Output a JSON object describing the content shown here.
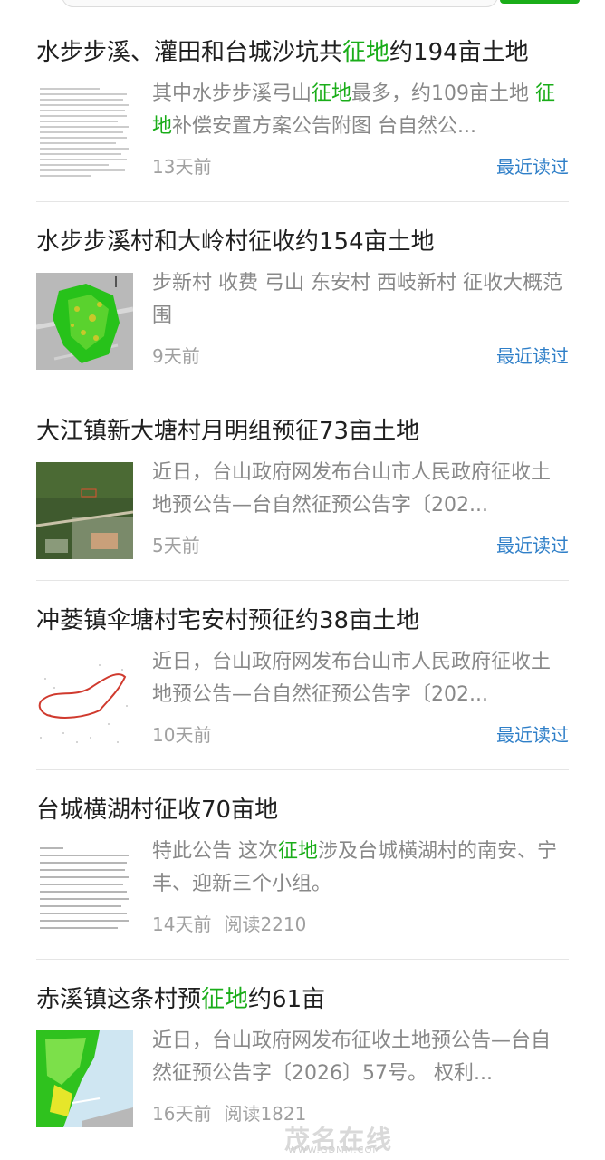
{
  "articles": [
    {
      "title_parts": [
        "水步步溪、灌田和台城沙坑共",
        "征地",
        "约194亩土地"
      ],
      "snippet_parts": [
        "其中水步步溪弓山",
        "征地",
        "最多，约109亩土地 ",
        "征地",
        "补偿安置方案公告附图 台自然公..."
      ],
      "time": "13天前",
      "status": "最近读过",
      "thumb": "document-thumbnail"
    },
    {
      "title_parts": [
        "水步步溪村和大岭村征收约154亩土地",
        "",
        ""
      ],
      "snippet_parts": [
        "步新村 收费 弓山 东安村 西岐新村 征收大概范围",
        "",
        "",
        "",
        ""
      ],
      "time": "9天前",
      "status": "最近读过",
      "thumb": "map-green-thumbnail"
    },
    {
      "title_parts": [
        "大江镇新大塘村月明组预征73亩土地",
        "",
        ""
      ],
      "snippet_parts": [
        "近日，台山政府网发布台山市人民政府征收土地预公告—台自然征预公告字〔202...",
        "",
        "",
        "",
        ""
      ],
      "time": "5天前",
      "status": "最近读过",
      "thumb": "satellite-thumbnail"
    },
    {
      "title_parts": [
        "冲蒌镇伞塘村宅安村预征约38亩土地",
        "",
        ""
      ],
      "snippet_parts": [
        "近日，台山政府网发布台山市人民政府征收土地预公告—台自然征预公告字〔202...",
        "",
        "",
        "",
        ""
      ],
      "time": "10天前",
      "status": "最近读过",
      "thumb": "boundary-map-thumbnail"
    },
    {
      "title_parts": [
        "台城横湖村征收70亩地",
        "",
        ""
      ],
      "snippet_parts": [
        "特此公告 这次",
        "征地",
        "涉及台城横湖村的南安、宁丰、迎新三个小组。",
        "",
        ""
      ],
      "time": "14天前",
      "reads": "阅读2210",
      "thumb": "document-thumbnail"
    },
    {
      "title_parts": [
        "赤溪镇这条村预",
        "征地",
        "约61亩"
      ],
      "snippet_parts": [
        "近日，台山政府网发布征收土地预公告—台自然征预公告字〔2026〕57号。 权利...",
        "",
        "",
        "",
        ""
      ],
      "time": "16天前",
      "reads": "阅读1821",
      "thumb": "map-green-thumbnail"
    }
  ],
  "watermark": {
    "main": "茂名在线",
    "sub": "WWW.GDMM.COM"
  },
  "colors": {
    "highlight": "#1aad19",
    "link": "#2f7fc8",
    "meta": "#a0a0a0"
  }
}
